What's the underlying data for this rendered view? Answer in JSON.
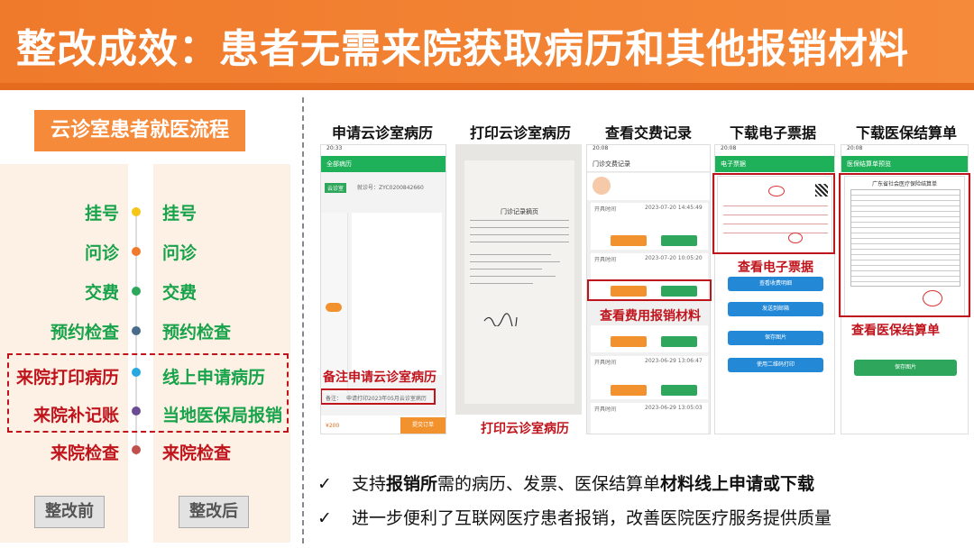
{
  "slide_title": "整改成效：患者无需来院获取病历和其他报销材料",
  "left": {
    "title": "云诊室患者就医流程",
    "before_label": "整改前",
    "after_label": "整改后",
    "before_steps": [
      "挂号",
      "问诊",
      "交费",
      "预约检查",
      "来院打印病历",
      "来院补记账",
      "来院检查"
    ],
    "after_steps": [
      "挂号",
      "问诊",
      "交费",
      "预约检查",
      "线上申请病历",
      "当地医保局报销",
      "来院检查"
    ],
    "colors": {
      "green": "#17a34a",
      "red": "#c0141c",
      "orange": "#f58a3a"
    }
  },
  "screens": {
    "titles": [
      "申请云诊室病历",
      "打印云诊室病历",
      "查看交费记录",
      "下载电子票据",
      "下载医保结算单"
    ],
    "captions": {
      "apply": "备注申请云诊室病历",
      "print": "打印云诊室病历",
      "fee": "查看费用报销材料",
      "invoice": "查看电子票据",
      "settlement": "查看医保结算单"
    },
    "apply_phone": {
      "header": "全部病历",
      "tab": "云诊室",
      "doctor_id": "就诊号：ZYC0200842660",
      "remark_prefix": "备注：",
      "remark_text": "申请打印2023年05月云诊室病历",
      "price": "¥200",
      "submit": "提交订单"
    },
    "fee_phone": {
      "header": "门诊交费记录",
      "rows": [
        {
          "label": "开具时间",
          "value": "2023-07-20 14:45:49"
        },
        {
          "label": "开具时间",
          "value": "2023-07-20 10:05:20"
        },
        {
          "label": "开具时间",
          "value": "2023-06-29 13:06:47"
        },
        {
          "label": "开具时间",
          "value": "2023-06-29 13:05:03"
        }
      ]
    },
    "invoice_phone": {
      "header": "电子票据",
      "buttons": [
        "查看收费明细",
        "发送到邮箱",
        "保存图片",
        "使用二维码打印"
      ]
    },
    "settlement_phone": {
      "header": "医保结算单预览",
      "doc_title": "广东省社会医疗保险结算单",
      "button": "保存图片"
    },
    "paper": {
      "title": "门诊记录摘页"
    }
  },
  "bullets": [
    {
      "check": "✓",
      "parts": [
        "支持",
        "报销所",
        "需的病历、发票、医保结算单",
        "材料线上申请或下载"
      ]
    },
    {
      "check": "✓",
      "parts": [
        "进一步便利了互联网医疗患者报销，改善医院医疗服务提供质量"
      ]
    }
  ]
}
